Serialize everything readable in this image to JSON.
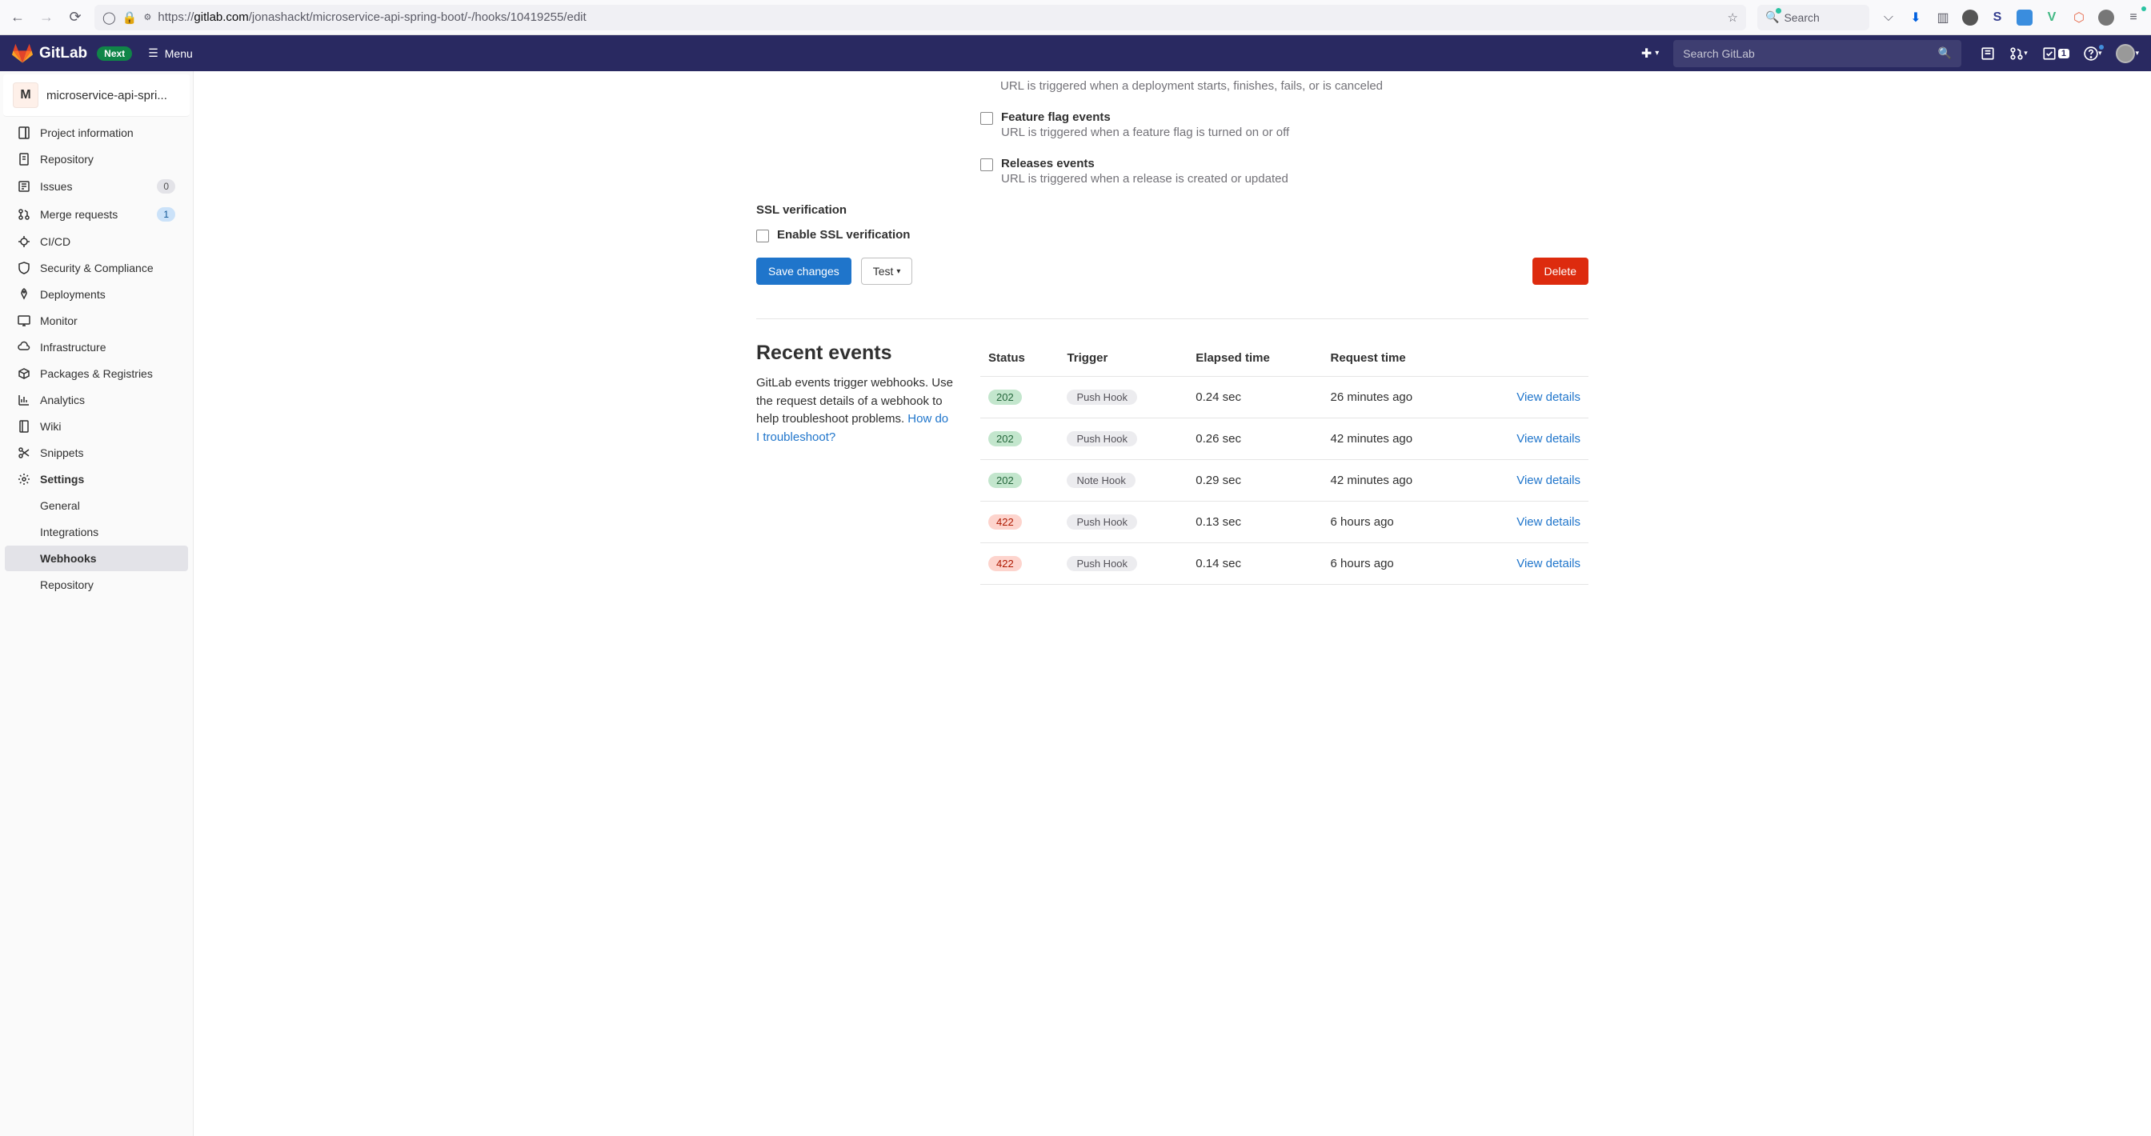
{
  "browser": {
    "url_prefix": "https://",
    "url_domain": "gitlab.com",
    "url_path": "/jonashackt/microservice-api-spring-boot/-/hooks/10419255/edit",
    "search_placeholder": "Search"
  },
  "header": {
    "brand": "GitLab",
    "next": "Next",
    "menu": "Menu",
    "search_placeholder": "Search GitLab",
    "todos_count": "1"
  },
  "project": {
    "avatar_letter": "M",
    "name": "microservice-api-spri..."
  },
  "sidebar": {
    "items": [
      {
        "label": "Project information"
      },
      {
        "label": "Repository"
      },
      {
        "label": "Issues",
        "count": "0"
      },
      {
        "label": "Merge requests",
        "count": "1"
      },
      {
        "label": "CI/CD"
      },
      {
        "label": "Security & Compliance"
      },
      {
        "label": "Deployments"
      },
      {
        "label": "Monitor"
      },
      {
        "label": "Infrastructure"
      },
      {
        "label": "Packages & Registries"
      },
      {
        "label": "Analytics"
      },
      {
        "label": "Wiki"
      },
      {
        "label": "Snippets"
      },
      {
        "label": "Settings"
      }
    ],
    "settings_children": [
      {
        "label": "General"
      },
      {
        "label": "Integrations"
      },
      {
        "label": "Webhooks"
      },
      {
        "label": "Repository"
      }
    ]
  },
  "form": {
    "deploy_desc": "URL is triggered when a deployment starts, finishes, fails, or is canceled",
    "feature_flag_title": "Feature flag events",
    "feature_flag_desc": "URL is triggered when a feature flag is turned on or off",
    "releases_title": "Releases events",
    "releases_desc": "URL is triggered when a release is created or updated",
    "ssl_section": "SSL verification",
    "ssl_enable": "Enable SSL verification",
    "save": "Save changes",
    "test": "Test",
    "delete": "Delete"
  },
  "recent": {
    "title": "Recent events",
    "desc": "GitLab events trigger webhooks. Use the request details of a webhook to help troubleshoot problems. ",
    "help_link": "How do I troubleshoot?",
    "columns": {
      "status": "Status",
      "trigger": "Trigger",
      "elapsed": "Elapsed time",
      "request": "Request time"
    },
    "view_label": "View details",
    "rows": [
      {
        "status": "202",
        "status_class": "success",
        "trigger": "Push Hook",
        "elapsed": "0.24 sec",
        "request": "26 minutes ago"
      },
      {
        "status": "202",
        "status_class": "success",
        "trigger": "Push Hook",
        "elapsed": "0.26 sec",
        "request": "42 minutes ago"
      },
      {
        "status": "202",
        "status_class": "success",
        "trigger": "Note Hook",
        "elapsed": "0.29 sec",
        "request": "42 minutes ago"
      },
      {
        "status": "422",
        "status_class": "error",
        "trigger": "Push Hook",
        "elapsed": "0.13 sec",
        "request": "6 hours ago"
      },
      {
        "status": "422",
        "status_class": "error",
        "trigger": "Push Hook",
        "elapsed": "0.14 sec",
        "request": "6 hours ago"
      }
    ]
  }
}
